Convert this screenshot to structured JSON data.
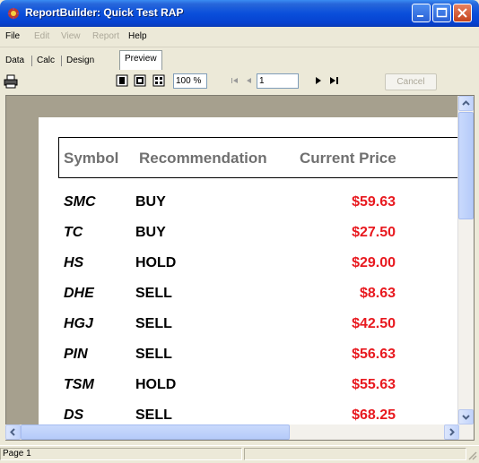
{
  "window": {
    "title": "ReportBuilder: Quick Test RAP"
  },
  "menu": [
    {
      "label": "File",
      "enabled": true
    },
    {
      "label": "Edit",
      "enabled": false
    },
    {
      "label": "View",
      "enabled": false
    },
    {
      "label": "Report",
      "enabled": false
    },
    {
      "label": "Help",
      "enabled": true
    }
  ],
  "tabs": [
    {
      "label": "Data",
      "active": false
    },
    {
      "label": "Calc",
      "active": false
    },
    {
      "label": "Design",
      "active": false
    },
    {
      "label": "Preview",
      "active": true
    }
  ],
  "toolbar": {
    "zoom": "100 %",
    "page_number": "1",
    "cancel_label": "Cancel"
  },
  "report": {
    "headers": [
      "Symbol",
      "Recommendation",
      "Current Price"
    ],
    "rows": [
      {
        "symbol": "SMC",
        "recommendation": "BUY",
        "price": "$59.63"
      },
      {
        "symbol": "TC",
        "recommendation": "BUY",
        "price": "$27.50"
      },
      {
        "symbol": "HS",
        "recommendation": "HOLD",
        "price": "$29.00"
      },
      {
        "symbol": "DHE",
        "recommendation": "SELL",
        "price": "$8.63"
      },
      {
        "symbol": "HGJ",
        "recommendation": "SELL",
        "price": "$42.50"
      },
      {
        "symbol": "PIN",
        "recommendation": "SELL",
        "price": "$56.63"
      },
      {
        "symbol": "TSM",
        "recommendation": "HOLD",
        "price": "$55.63"
      },
      {
        "symbol": "DS",
        "recommendation": "SELL",
        "price": "$68.25"
      }
    ]
  },
  "colors": {
    "price": "#e8191f",
    "header_text": "#707070",
    "viewport_bg": "#a6a08e"
  },
  "status": {
    "page": "Page 1"
  }
}
